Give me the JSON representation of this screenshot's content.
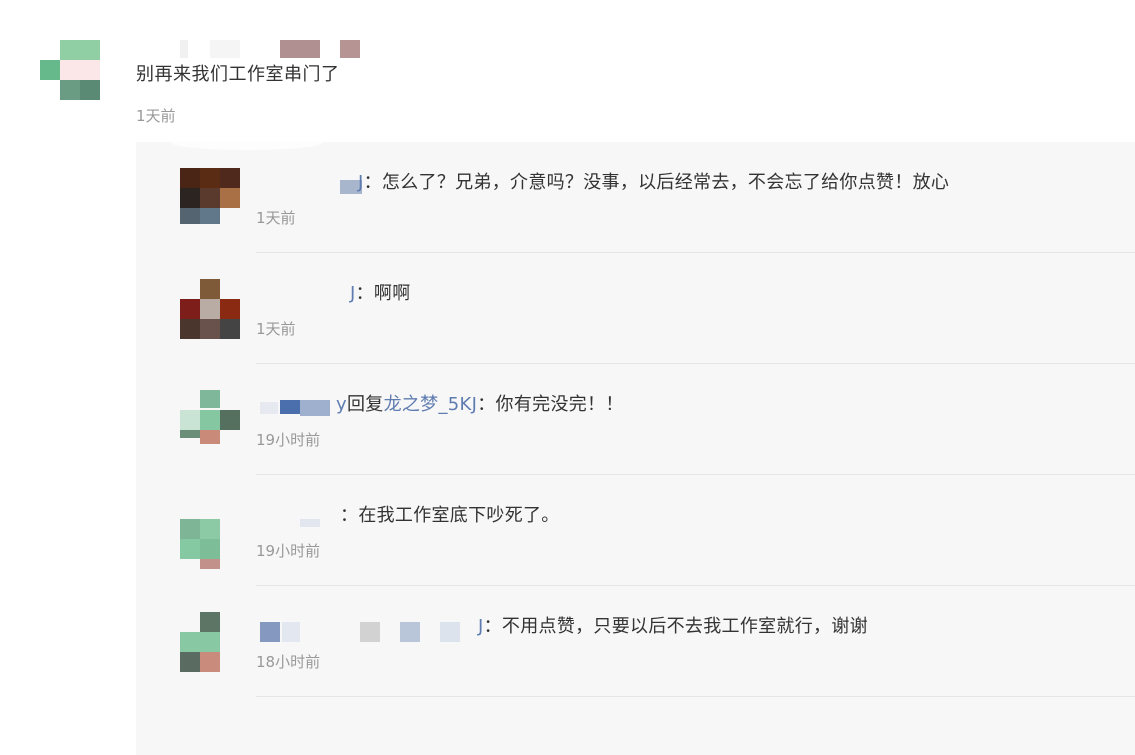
{
  "main_comment": {
    "text": "别再来我们工作室串门了",
    "time": "1天前"
  },
  "replies": [
    {
      "author_tail": "J",
      "separator": "：",
      "text": "怎么了？兄弟，介意吗？没事，以后经常去，不会忘了给你点赞！放心",
      "time": "1天前"
    },
    {
      "author_tail": "J",
      "separator": "：",
      "text": "啊啊",
      "time": "1天前"
    },
    {
      "author_tail": "y",
      "reply_word": "回复",
      "reply_target": "龙之梦_5KJ",
      "separator": "：",
      "text": "你有完没完！！",
      "time": "19小时前"
    },
    {
      "author_tail": "",
      "separator": "：",
      "text": "在我工作室底下吵死了。",
      "time": "19小时前"
    },
    {
      "author_tail": "J",
      "separator": "：",
      "text": "不用点赞，只要以后不去我工作室就行，谢谢",
      "time": "18小时前"
    }
  ]
}
